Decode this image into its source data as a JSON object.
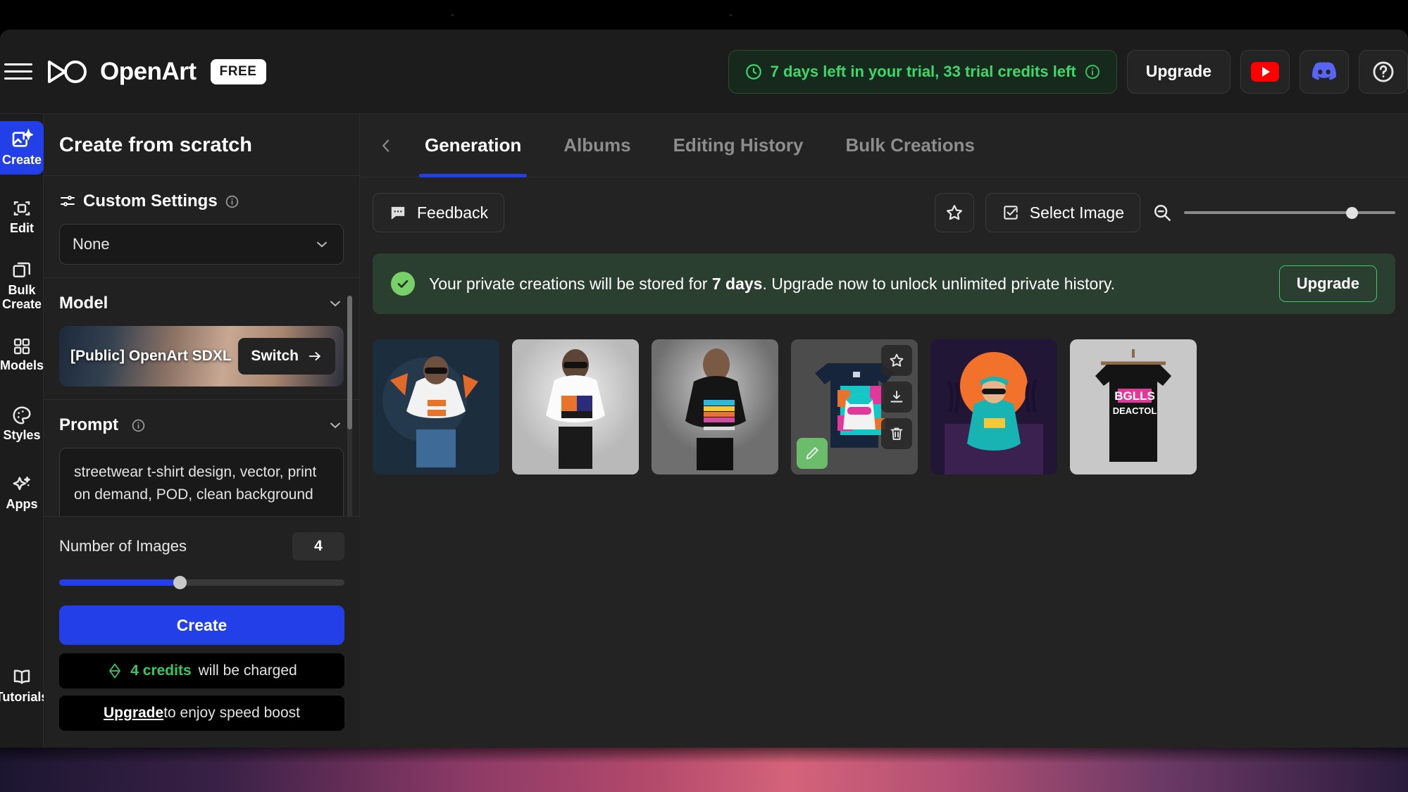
{
  "app": {
    "brand_name": "OpenArt",
    "plan_badge": "FREE"
  },
  "header": {
    "trial_text": "7 days left in your trial, 33 trial credits left",
    "upgrade_label": "Upgrade",
    "icons": {
      "menu": "hamburger-icon",
      "clock": "clock-icon",
      "info": "info-icon",
      "youtube": "youtube-icon",
      "discord": "discord-icon",
      "help": "help-circle-icon"
    }
  },
  "rail": {
    "items": [
      {
        "label": "Create",
        "icon": "image-sparkle-icon",
        "active": true
      },
      {
        "label": "Edit",
        "icon": "crop-frame-icon",
        "active": false
      },
      {
        "label": "Bulk\nCreate",
        "icon": "layers-icon",
        "active": false
      },
      {
        "label": "Models",
        "icon": "grid-squares-icon",
        "active": false
      },
      {
        "label": "Styles",
        "icon": "palette-icon",
        "active": false
      },
      {
        "label": "Apps",
        "icon": "sparkles-icon",
        "active": false
      }
    ],
    "bottom_item": {
      "label": "Tutorials",
      "icon": "book-icon"
    }
  },
  "panel": {
    "title": "Create from scratch",
    "custom_settings": {
      "label": "Custom Settings",
      "selected": "None"
    },
    "model": {
      "label": "Model",
      "name": "[Public] OpenArt SDXL",
      "switch_label": "Switch"
    },
    "prompt": {
      "label": "Prompt",
      "value": "streetwear t-shirt design, vector, print on demand, POD, clean background"
    },
    "number_of_images": {
      "label": "Number of Images",
      "value": "4"
    },
    "create_label": "Create",
    "credits_amount": "4 credits",
    "credits_suffix": " will be charged",
    "speed_upgrade_link": "Upgrade",
    "speed_upgrade_suffix": " to enjoy speed boost"
  },
  "main": {
    "tabs": [
      {
        "label": "Generation",
        "active": true
      },
      {
        "label": "Albums",
        "active": false
      },
      {
        "label": "Editing History",
        "active": false
      },
      {
        "label": "Bulk Creations",
        "active": false
      }
    ],
    "toolbar": {
      "feedback_label": "Feedback",
      "select_image_label": "Select Image",
      "favorite_icon": "star-icon",
      "zoom_out_icon": "magnifier-minus-icon"
    },
    "notice": {
      "text_before": "Your private creations will be stored for ",
      "highlight": "7 days",
      "text_after": ". Upgrade now to unlock unlimited private history.",
      "button_label": "Upgrade"
    },
    "thumbnails": [
      {
        "name": "generated-image-1"
      },
      {
        "name": "generated-image-2"
      },
      {
        "name": "generated-image-3"
      },
      {
        "name": "generated-image-4"
      },
      {
        "name": "generated-image-5"
      },
      {
        "name": "generated-image-6"
      }
    ],
    "hover_actions": {
      "favorite": "star-icon",
      "download": "download-icon",
      "delete": "trash-icon",
      "edit": "pencil-icon"
    }
  },
  "colors": {
    "accent_blue": "#2340e8",
    "trial_green": "#3dd86a",
    "notice_green": "#2a3f2f",
    "panel_bg": "#212121",
    "main_bg": "#232323"
  }
}
